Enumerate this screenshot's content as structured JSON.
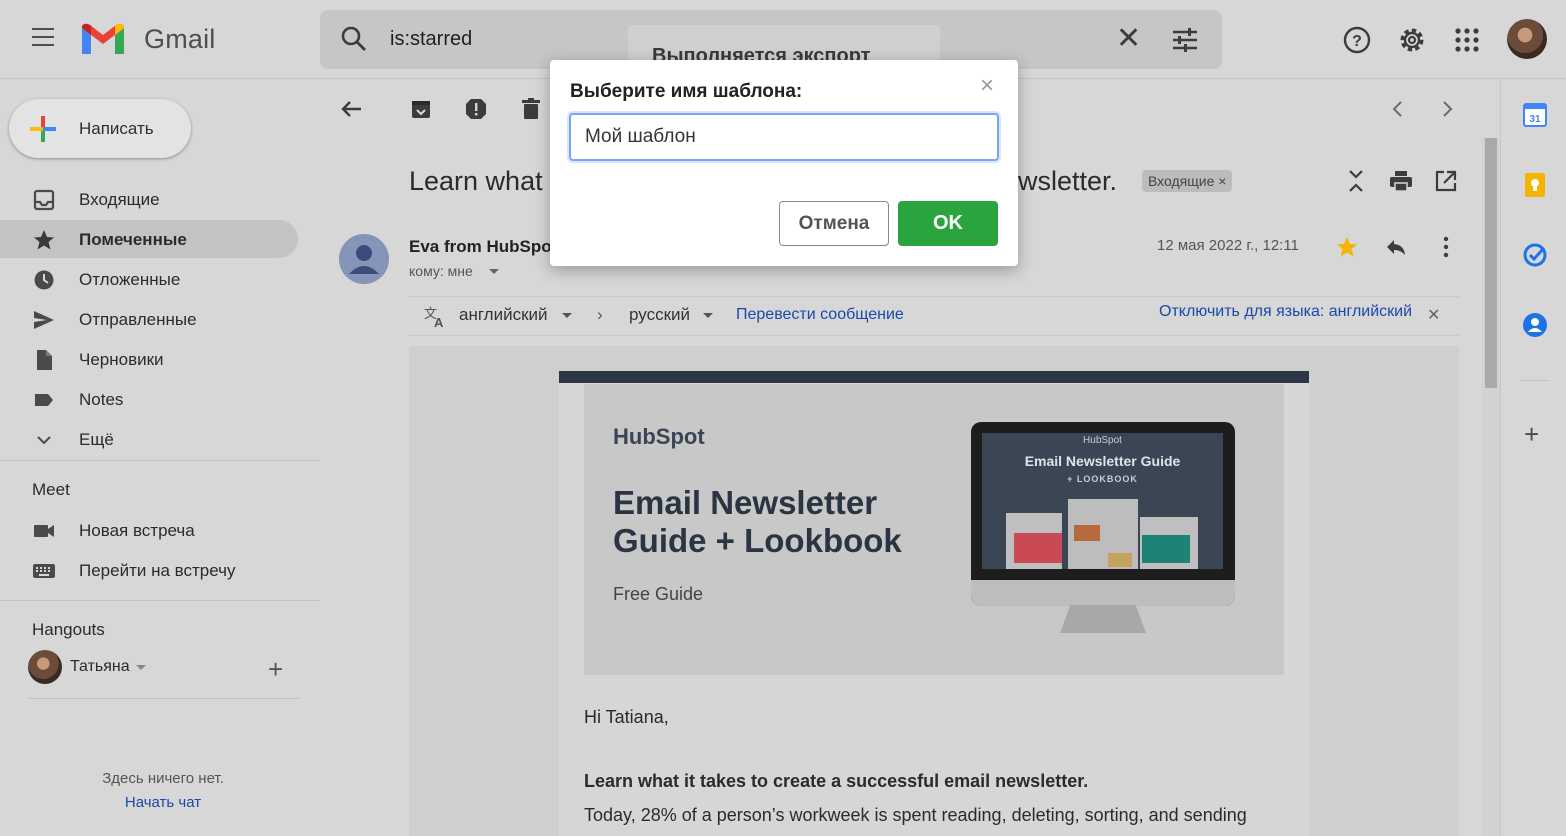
{
  "header": {
    "app_name": "Gmail",
    "search_query": "is:starred",
    "export_toast": "Выполняется экспорт"
  },
  "sidebar": {
    "compose_label": "Написать",
    "items": [
      {
        "label": "Входящие",
        "icon": "inbox-icon"
      },
      {
        "label": "Помеченные",
        "icon": "star-icon"
      },
      {
        "label": "Отложенные",
        "icon": "clock-icon"
      },
      {
        "label": "Отправленные",
        "icon": "send-icon"
      },
      {
        "label": "Черновики",
        "icon": "draft-icon"
      },
      {
        "label": "Notes",
        "icon": "label-icon"
      },
      {
        "label": "Ещё",
        "icon": "chevron-down-icon"
      }
    ],
    "meet": {
      "title": "Meet",
      "new_meeting": "Новая встреча",
      "join_meeting": "Перейти на встречу"
    },
    "hangouts": {
      "title": "Hangouts",
      "user_name": "Татьяна",
      "empty_text": "Здесь ничего нет.",
      "start_chat": "Начать чат"
    }
  },
  "message": {
    "subject_left": "Learn what",
    "subject_right": "ewsletter.",
    "label_chip": "Входящие ×",
    "sender": "Eva from HubSpo",
    "to": "кому: мне",
    "date": "12 мая 2022 г., 12:11",
    "translate": {
      "from_lang": "английский",
      "to_lang": "русский",
      "translate_link": "Перевести сообщение",
      "disable_link": "Отключить для языка: английский"
    },
    "email": {
      "brand": "HubSpot",
      "hero_title_line1": "Email Newsletter",
      "hero_title_line2": "Guide + Lookbook",
      "hero_sub": "Free Guide",
      "screen_brand": "HubSpot",
      "screen_title": "Email Newsletter Guide",
      "screen_sub": "+ LOOKBOOK",
      "greeting": "Hi Tatiana,",
      "bold_line": "Learn what it takes to create a successful email newsletter.",
      "text_line": "Today, 28% of a person’s workweek is spent reading, deleting, sorting, and sending"
    }
  },
  "modal": {
    "title": "Выберите имя шаблона:",
    "input_value": "Мой шаблон",
    "cancel_label": "Отмена",
    "ok_label": "OK",
    "ok_color": "#2aa43f"
  },
  "colors": {
    "accent_blue": "#1a73e8",
    "star_yellow": "#f4b400"
  }
}
